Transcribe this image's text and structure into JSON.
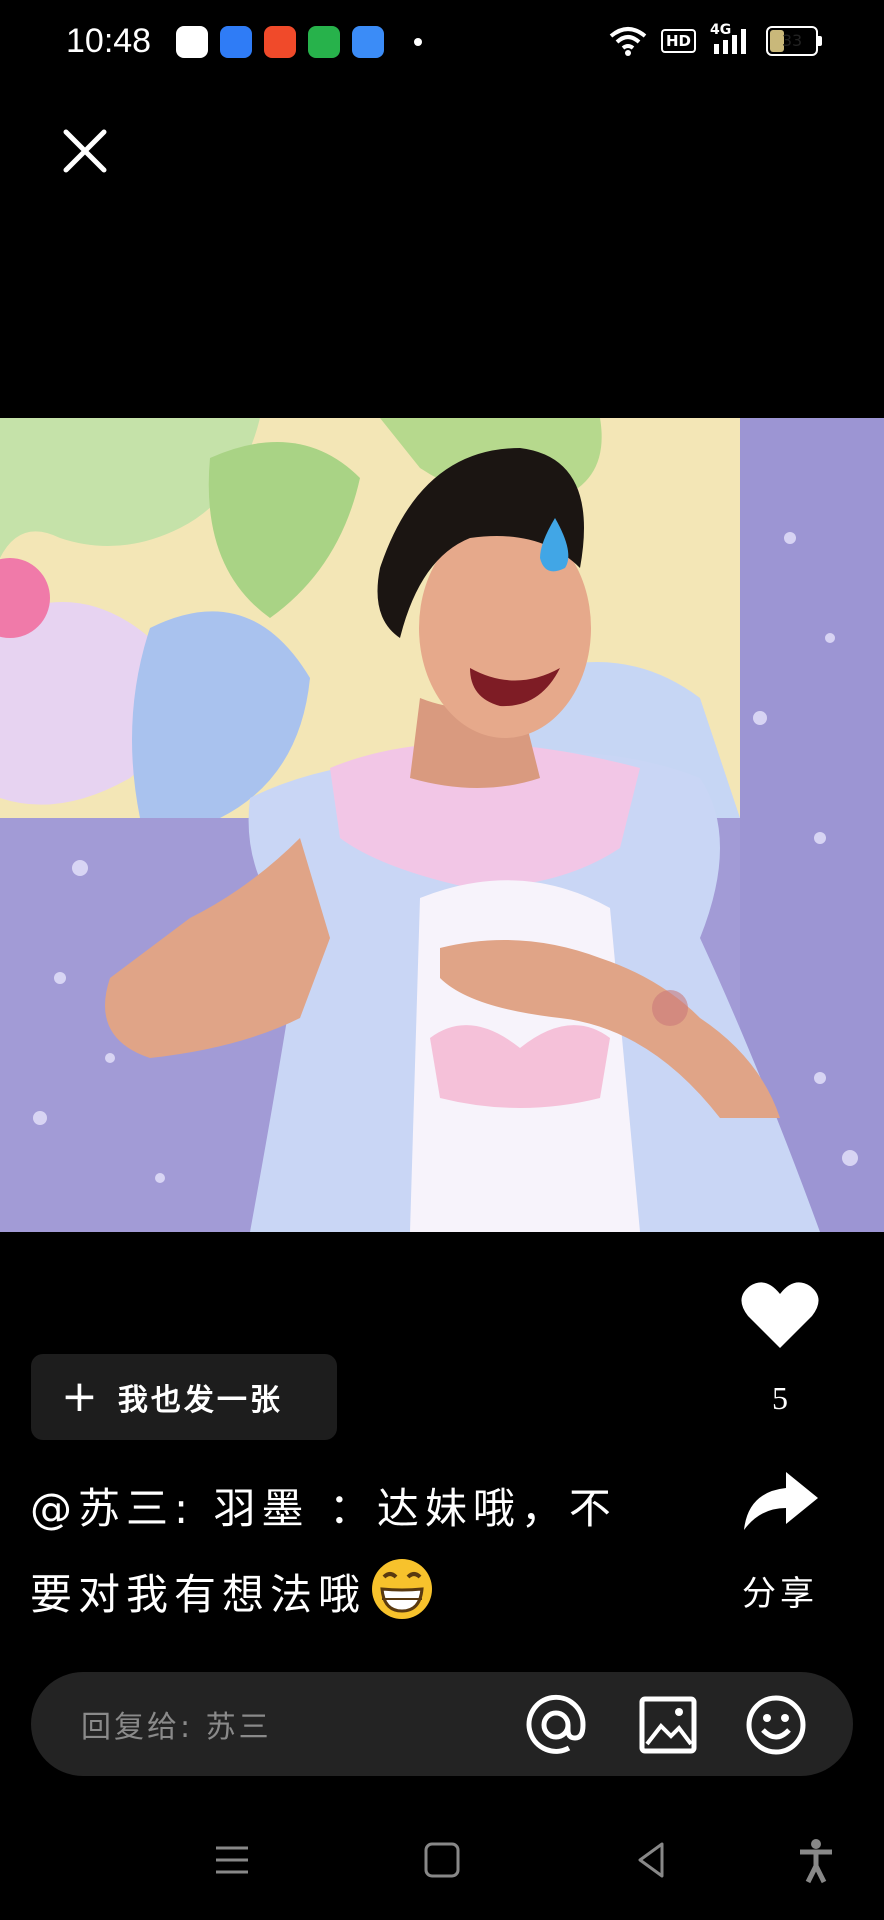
{
  "status_bar": {
    "time": "10:48",
    "hd_badge": "HD",
    "network": "4G",
    "battery_level": "33",
    "app_icon_colors": [
      "#ffffff",
      "#2f7cf6",
      "#f04a2a",
      "#27b24b",
      "#3b8cf7"
    ]
  },
  "icons": {
    "close": "close-icon",
    "like": "heart-icon",
    "share": "share-arrow-icon",
    "mention": "at-icon",
    "image": "image-icon",
    "emoji": "smiley-icon"
  },
  "actions": {
    "like_count": "5",
    "share_label": "分享",
    "post_button_plus": "+",
    "post_button_label": "我也发一张"
  },
  "caption": {
    "line1": "@苏三: 羽墨 ：达妹哦，不",
    "line2": "要对我有想法哦"
  },
  "reply": {
    "placeholder": "回复给: 苏三"
  },
  "colors": {
    "background": "#000000",
    "panel": "#232323",
    "button_bg": "#1d1d1d",
    "placeholder": "#8a8a8a"
  }
}
